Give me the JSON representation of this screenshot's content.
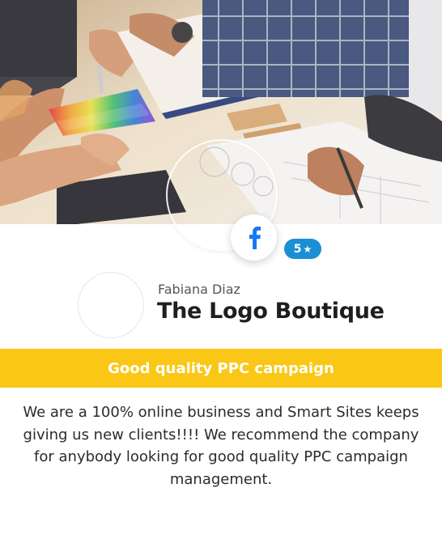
{
  "review": {
    "rating": "5",
    "star": "★",
    "reviewer_name": "Fabiana Diaz",
    "business_name": "The Logo Boutique",
    "headline": "Good quality PPC campaign",
    "body": "We are a 100% online business and Smart Sites keeps giving us new clients!!!! We recommend the company for anybody looking for good quality PPC campaign management."
  },
  "platform": {
    "icon": "facebook-icon",
    "color": "#1877f2"
  },
  "colors": {
    "headline_bar": "#fac716",
    "rating_pill": "#1a8fd6"
  }
}
